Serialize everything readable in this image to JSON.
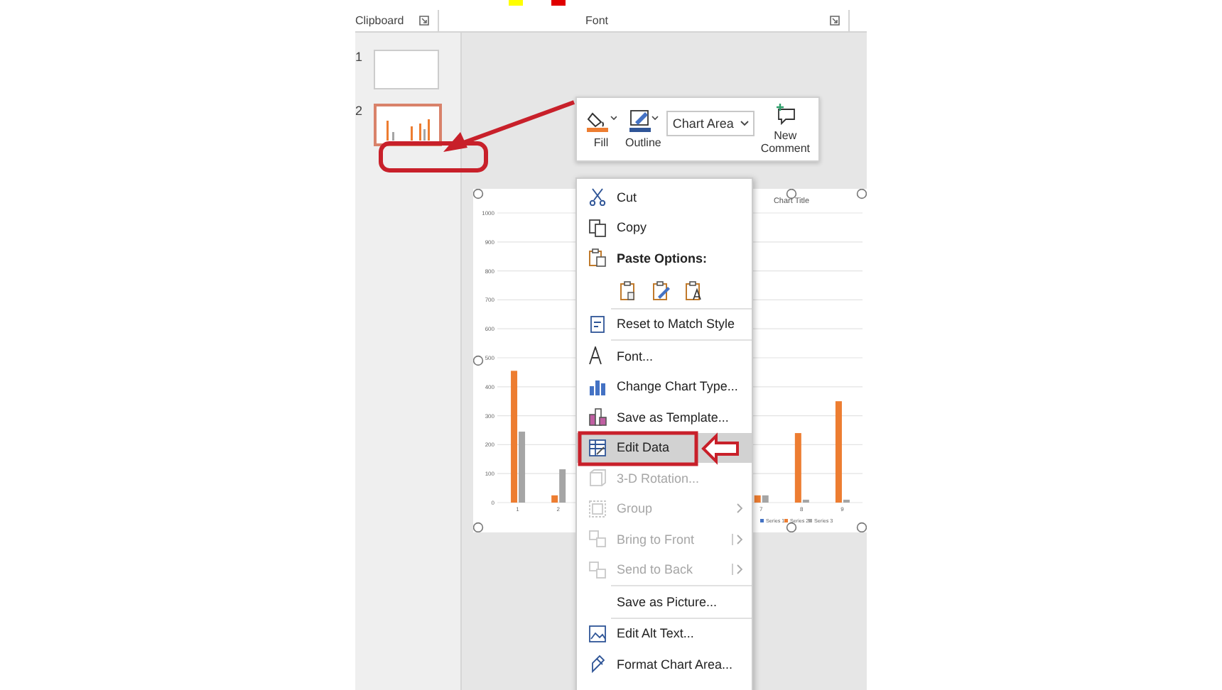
{
  "ribbon": {
    "groups": [
      {
        "label": "Clipboard"
      },
      {
        "label": "Font"
      }
    ]
  },
  "slides": [
    {
      "number": "1",
      "selected": false
    },
    {
      "number": "2",
      "selected": true
    }
  ],
  "mini_toolbar": {
    "fill_label": "Fill",
    "outline_label": "Outline",
    "element_select": {
      "value": "Chart Area"
    },
    "new_comment_label": "New Comment"
  },
  "chart": {
    "chart_data": {
      "type": "bar",
      "title": "Chart Title",
      "x": [
        1,
        2,
        7,
        8,
        9
      ],
      "xlim": [
        0.5,
        9.5
      ],
      "xticks": [
        1,
        2,
        7,
        8,
        9
      ],
      "grid": true,
      "legend": true,
      "stacked": false,
      "yticks": [
        0,
        100,
        200,
        300,
        400,
        500,
        600,
        700,
        800,
        900,
        1000
      ],
      "ylim": [
        0,
        1000
      ],
      "series": [
        {
          "name": "Series 1",
          "color": "#4472c4",
          "values": [
            null,
            null,
            null,
            null,
            null
          ]
        },
        {
          "name": "Series 2",
          "color": "#ed7d31",
          "values": [
            455,
            25,
            25,
            240,
            350
          ]
        },
        {
          "name": "Series 3",
          "color": "#a5a5a5",
          "values": [
            245,
            115,
            25,
            10,
            10
          ]
        }
      ]
    }
  },
  "context_menu": {
    "sections": [
      [
        {
          "kind": "command",
          "label": "Cut",
          "disabled": false,
          "selected": false
        },
        {
          "kind": "command",
          "label": "Copy",
          "disabled": false,
          "selected": false
        },
        {
          "kind": "header",
          "label": "Paste Options:"
        },
        {
          "kind": "paste_row"
        }
      ],
      [
        {
          "kind": "command",
          "label": "Reset to Match Style",
          "disabled": false,
          "selected": false
        }
      ],
      [
        {
          "kind": "command",
          "label": "Font...",
          "disabled": false,
          "selected": false
        },
        {
          "kind": "command",
          "label": "Change Chart Type...",
          "disabled": false,
          "selected": false
        },
        {
          "kind": "command",
          "label": "Save as Template...",
          "disabled": false,
          "selected": false
        },
        {
          "kind": "command",
          "label": "Edit Data",
          "disabled": false,
          "selected": true
        },
        {
          "kind": "command",
          "label": "3-D Rotation...",
          "disabled": true,
          "selected": false
        },
        {
          "kind": "submenu",
          "label": "Group",
          "disabled": true,
          "selected": false
        },
        {
          "kind": "split",
          "label": "Bring to Front",
          "disabled": true,
          "selected": false
        },
        {
          "kind": "split",
          "label": "Send to Back",
          "disabled": true,
          "selected": false
        }
      ],
      [
        {
          "kind": "command",
          "label": "Save as Picture...",
          "disabled": false,
          "selected": false
        }
      ],
      [
        {
          "kind": "command",
          "label": "Edit Alt Text...",
          "disabled": false,
          "selected": false
        },
        {
          "kind": "command",
          "label": "Format Chart Area...",
          "disabled": false,
          "selected": false
        }
      ]
    ]
  }
}
